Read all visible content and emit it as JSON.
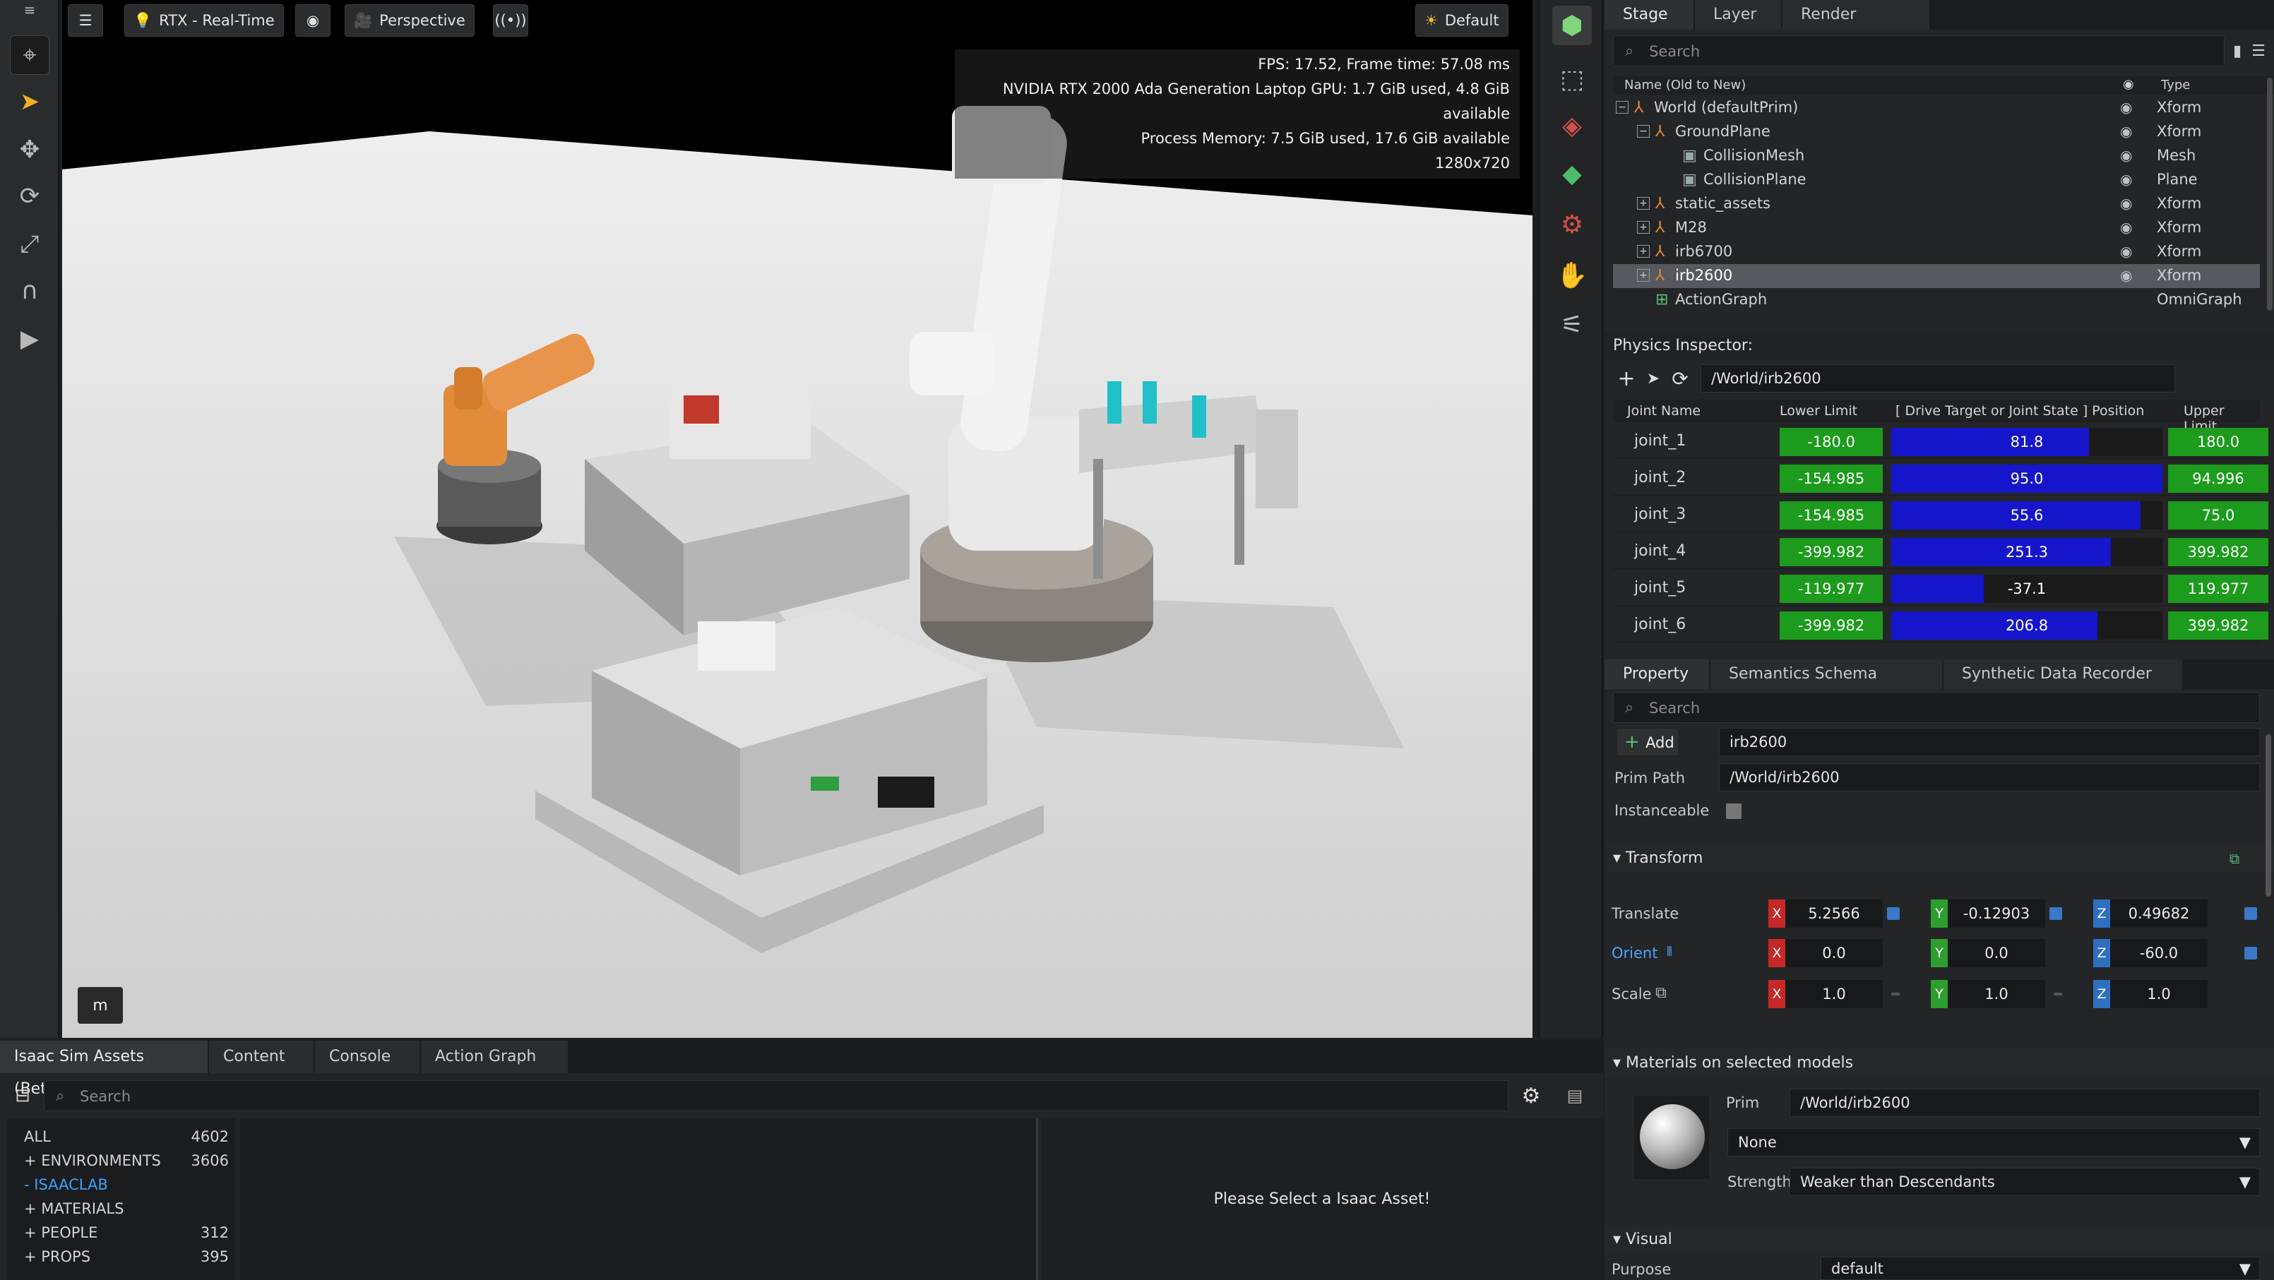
{
  "toolbar": {
    "rtx_label": "RTX - Real-Time",
    "camera_label": "Perspective",
    "lighting_label": "Default"
  },
  "viewport": {
    "fps": "FPS: 17.52, Frame time: 57.08 ms",
    "gpu": "NVIDIA RTX 2000 Ada Generation Laptop GPU: 1.7 GiB used, 4.8 GiB available",
    "memory": "Process Memory: 7.5 GiB used, 17.6 GiB available",
    "resolution": "1280x720",
    "badge": "m"
  },
  "stage": {
    "tabs": [
      "Stage",
      "Layer",
      "Render Settings"
    ],
    "search_placeholder": "Search",
    "col_name": "Name (Old to New)",
    "col_type": "Type",
    "rows": [
      {
        "name": "World (defaultPrim)",
        "type": "Xform"
      },
      {
        "name": "GroundPlane",
        "type": "Xform"
      },
      {
        "name": "CollisionMesh",
        "type": "Mesh"
      },
      {
        "name": "CollisionPlane",
        "type": "Plane"
      },
      {
        "name": "static_assets",
        "type": "Xform"
      },
      {
        "name": "M28",
        "type": "Xform"
      },
      {
        "name": "irb6700",
        "type": "Xform"
      },
      {
        "name": "irb2600",
        "type": "Xform"
      },
      {
        "name": "ActionGraph",
        "type": "OmniGraph"
      }
    ]
  },
  "physics": {
    "title": "Physics Inspector:",
    "path": "/World/irb2600",
    "headers": [
      "Joint Name",
      "Lower Limit",
      "[ Drive Target or Joint State ] Position",
      "Upper Limit"
    ],
    "joints": [
      {
        "name": "joint_1",
        "lower": "-180.0",
        "position": "81.8",
        "upper": "180.0",
        "fill": 0.73
      },
      {
        "name": "joint_2",
        "lower": "-154.985",
        "position": "95.0",
        "upper": "94.996",
        "fill": 1.0
      },
      {
        "name": "joint_3",
        "lower": "-154.985",
        "position": "55.6",
        "upper": "75.0",
        "fill": 0.92
      },
      {
        "name": "joint_4",
        "lower": "-399.982",
        "position": "251.3",
        "upper": "399.982",
        "fill": 0.81
      },
      {
        "name": "joint_5",
        "lower": "-119.977",
        "position": "-37.1",
        "upper": "119.977",
        "fill": 0.34
      },
      {
        "name": "joint_6",
        "lower": "-399.982",
        "position": "206.8",
        "upper": "399.982",
        "fill": 0.76
      }
    ]
  },
  "property": {
    "tabs": [
      "Property",
      "Semantics Schema Editor",
      "Synthetic Data Recorder"
    ],
    "search_placeholder": "Search",
    "add_label": "Add",
    "name_value": "irb2600",
    "prim_path_label": "Prim Path",
    "prim_path_value": "/World/irb2600",
    "instanceable_label": "Instanceable",
    "transform_label": "Transform",
    "translate_label": "Translate",
    "orient_label": "Orient",
    "scale_label": "Scale",
    "translate": {
      "x": "5.2566",
      "y": "-0.12903",
      "z": "0.49682"
    },
    "orient": {
      "x": "0.0",
      "y": "0.0",
      "z": "-60.0"
    },
    "scale": {
      "x": "1.0",
      "y": "1.0",
      "z": "1.0"
    },
    "materials_label": "Materials on selected models",
    "prim_label": "Prim",
    "prim_value": "/World/irb2600",
    "material_value": "None",
    "strength_label": "Strength",
    "strength_value": "Weaker than Descendants",
    "visual_label": "Visual",
    "purpose_label": "Purpose",
    "purpose_value": "default"
  },
  "bottom": {
    "tabs": [
      "Isaac Sim Assets (Beta)",
      "Content",
      "Console",
      "Action Graph"
    ],
    "search_placeholder": "Search",
    "categories": [
      {
        "label": "ALL",
        "count": "4602"
      },
      {
        "label": "+ ENVIRONMENTS",
        "count": "3606"
      },
      {
        "label": "- ISAACLAB",
        "count": ""
      },
      {
        "label": "+ MATERIALS",
        "count": ""
      },
      {
        "label": "+ PEOPLE",
        "count": "312"
      },
      {
        "label": "+ PROPS",
        "count": "395"
      }
    ],
    "empty_message": "Please Select a Isaac Asset!"
  },
  "colors": {
    "green": "#1c9b1c",
    "blue": "#1515cc",
    "x_axis": "#c62828",
    "y_axis": "#2e9e2e",
    "z_axis": "#2f6fc0",
    "accent": "#3aa3ff"
  }
}
